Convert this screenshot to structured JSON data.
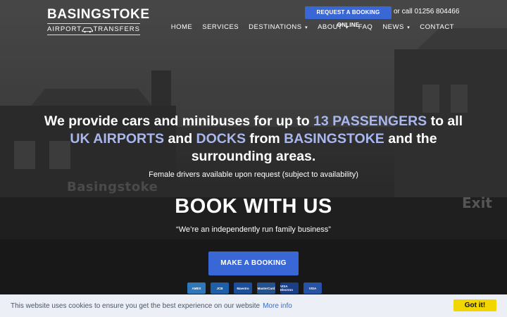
{
  "header": {
    "logo": {
      "brand": "BASINGSTOKE",
      "sub_left": "AIRPORT",
      "sub_right": "TRANSFERS",
      "icon": "car-icon"
    },
    "request_button": "REQUEST A BOOKING ONLINE",
    "phone_text": "or call 01256 804466",
    "nav": [
      {
        "label": "HOME",
        "dropdown": false
      },
      {
        "label": "SERVICES",
        "dropdown": false
      },
      {
        "label": "DESTINATIONS",
        "dropdown": true
      },
      {
        "label": "ABOUT",
        "dropdown": true
      },
      {
        "label": "FAQ",
        "dropdown": false
      },
      {
        "label": "NEWS",
        "dropdown": true
      },
      {
        "label": "CONTACT",
        "dropdown": false
      }
    ]
  },
  "hero": {
    "headline": {
      "p1": "We provide cars and minibuses for up to ",
      "h1": "13 PASSENGERS",
      "p2": " to all ",
      "h2": "UK AIRPORTS",
      "p3": " and ",
      "h3": "DOCKS",
      "p4": " from ",
      "h4": "BASINGSTOKE",
      "p5": " and the surrounding areas."
    },
    "subline": "Female drivers available upon request (subject to availability)",
    "book_title": "BOOK WITH US",
    "quote": "“We’re an independently run family business”",
    "make_booking": "MAKE A BOOKING",
    "payment_cards": [
      {
        "name": "AMEX",
        "color": "#2e77bb"
      },
      {
        "name": "JCB",
        "color": "#1f5fa8"
      },
      {
        "name": "Maestro",
        "color": "#1b4e9b"
      },
      {
        "name": "MasterCard",
        "color": "#25518f"
      },
      {
        "name": "VISA Electron",
        "color": "#1a3f87"
      },
      {
        "name": "VISA",
        "color": "#2653a6"
      }
    ],
    "background_sign": "Basingstoke",
    "background_exit": "Exit"
  },
  "cookie": {
    "text": "This website uses cookies to ensure you get the best experience on our website",
    "link": "More info",
    "button": "Got it!"
  },
  "colors": {
    "accent": "#3a67d6",
    "highlight": "#a9b7ee",
    "cookie_button": "#f1d600"
  }
}
